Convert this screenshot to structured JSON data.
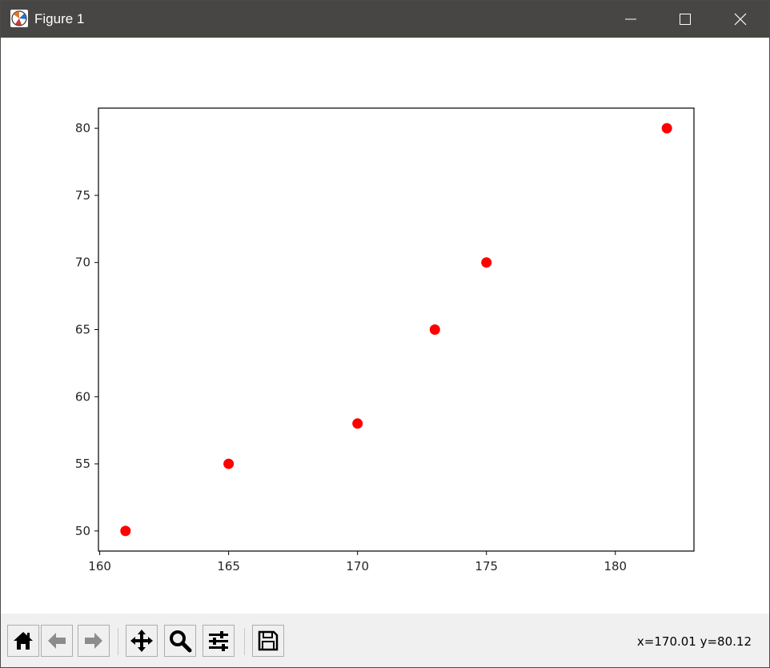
{
  "window": {
    "title": "Figure 1"
  },
  "toolbar": {
    "buttons": [
      {
        "name": "home",
        "icon": "home-icon"
      },
      {
        "name": "back",
        "icon": "back-arrow-icon"
      },
      {
        "name": "forward",
        "icon": "forward-arrow-icon"
      },
      {
        "name": "pan",
        "icon": "move-icon"
      },
      {
        "name": "zoom",
        "icon": "magnifier-icon"
      },
      {
        "name": "configure-subplots",
        "icon": "sliders-icon"
      },
      {
        "name": "save",
        "icon": "floppy-disk-icon"
      }
    ],
    "coordinates": "x=170.01 y=80.12"
  },
  "chart_data": {
    "type": "scatter",
    "title": "",
    "xlabel": "",
    "ylabel": "",
    "x": [
      161,
      165,
      170,
      173,
      175,
      182
    ],
    "y": [
      50,
      55,
      58,
      65,
      70,
      80
    ],
    "xlim": [
      159.95,
      183.05
    ],
    "ylim": [
      48.5,
      81.5
    ],
    "xticks": [
      160,
      165,
      170,
      175,
      180
    ],
    "yticks": [
      50,
      55,
      60,
      65,
      70,
      75,
      80
    ],
    "marker_color": "#ff0000",
    "grid": false
  }
}
